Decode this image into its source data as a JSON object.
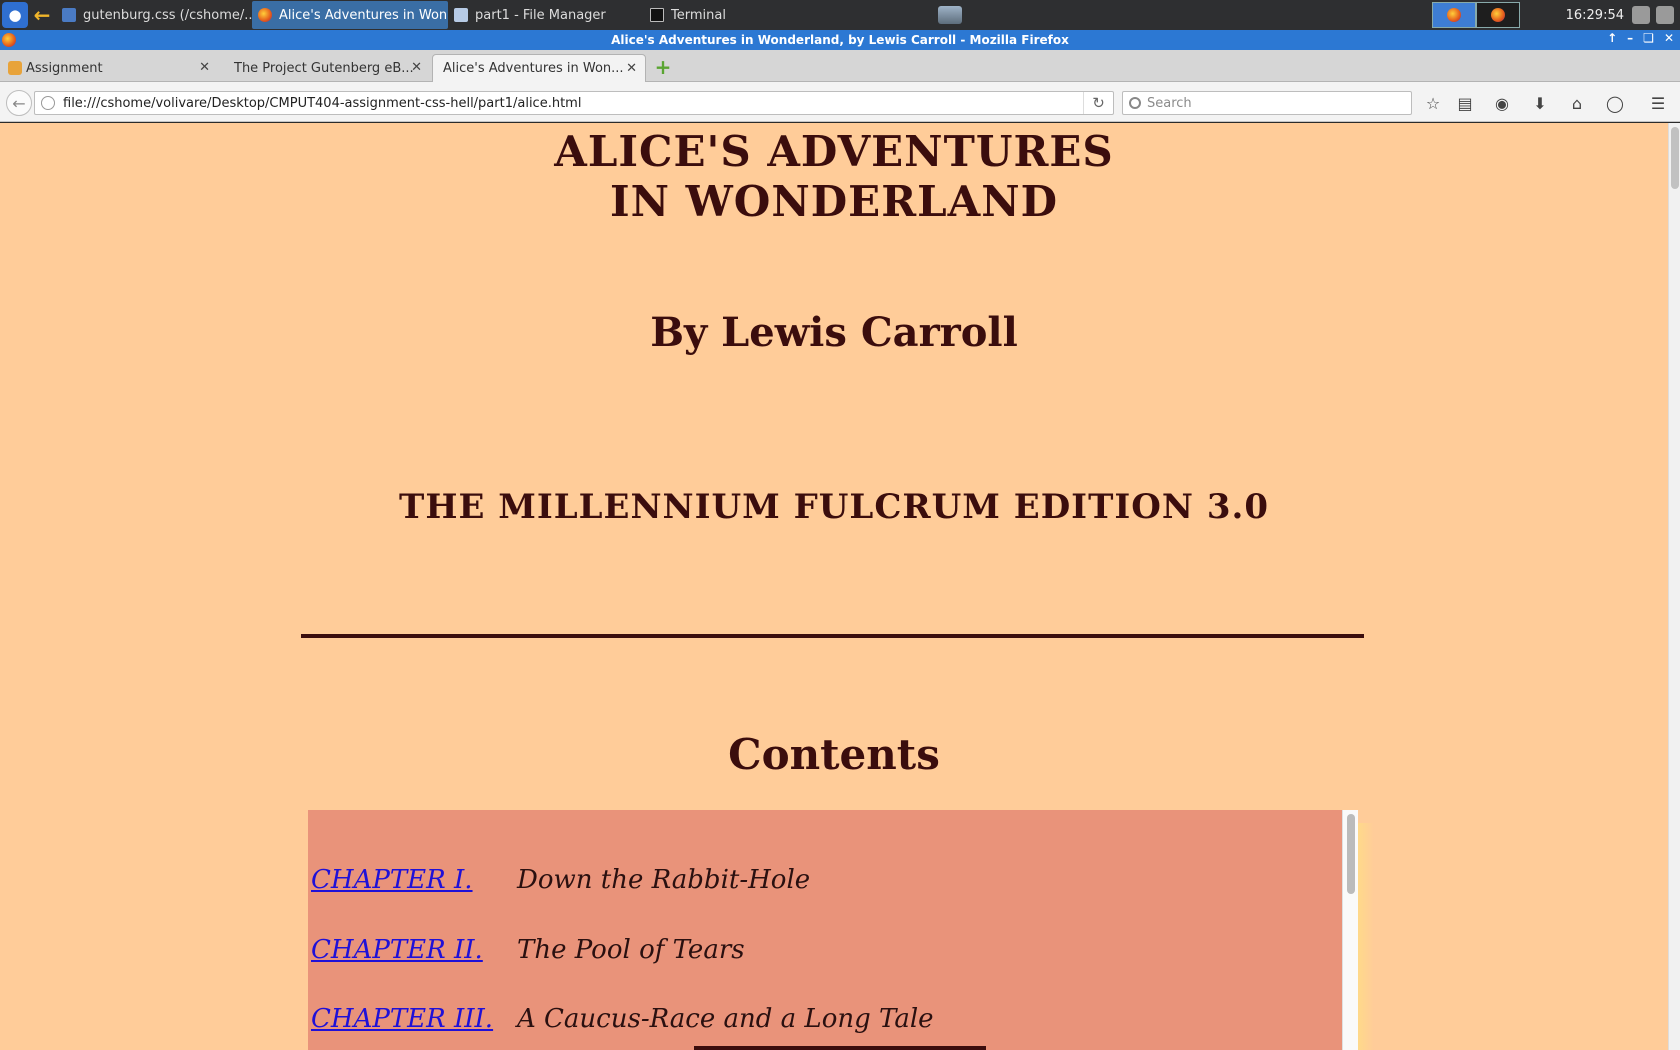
{
  "taskbar": {
    "tasks": [
      {
        "label": "gutenburg.css (/cshome/..."
      },
      {
        "label": "Alice's Adventures in Won..."
      },
      {
        "label": "part1 - File Manager"
      },
      {
        "label": "Terminal"
      }
    ],
    "clock": "16:29:54"
  },
  "window": {
    "title": "Alice's Adventures in Wonderland, by Lewis Carroll - Mozilla Firefox"
  },
  "tabs": [
    {
      "label": "Assignment"
    },
    {
      "label": "The Project Gutenberg eB..."
    },
    {
      "label": "Alice's Adventures in Won..."
    }
  ],
  "navbar": {
    "url": "file:///cshome/volivare/Desktop/CMPUT404-assignment-css-hell/part1/alice.html",
    "search_placeholder": "Search"
  },
  "page": {
    "title_line1": "ALICE'S ADVENTURES",
    "title_line2": "IN WONDERLAND",
    "byline": "By Lewis Carroll",
    "edition": "THE MILLENNIUM FULCRUM EDITION 3.0",
    "contents_heading": "Contents",
    "toc": [
      {
        "chapter": "CHAPTER I.",
        "name": "Down the Rabbit-Hole"
      },
      {
        "chapter": "CHAPTER II.",
        "name": "The Pool of Tears"
      },
      {
        "chapter": "CHAPTER III.",
        "name": "A Caucus-Race and a Long Tale"
      }
    ]
  },
  "colors": {
    "page_background": "#ffcc99",
    "text": "#3b0d0d",
    "toc_background": "#e9937a",
    "link": "#1f10d8",
    "titlebar": "#2c78d3"
  }
}
